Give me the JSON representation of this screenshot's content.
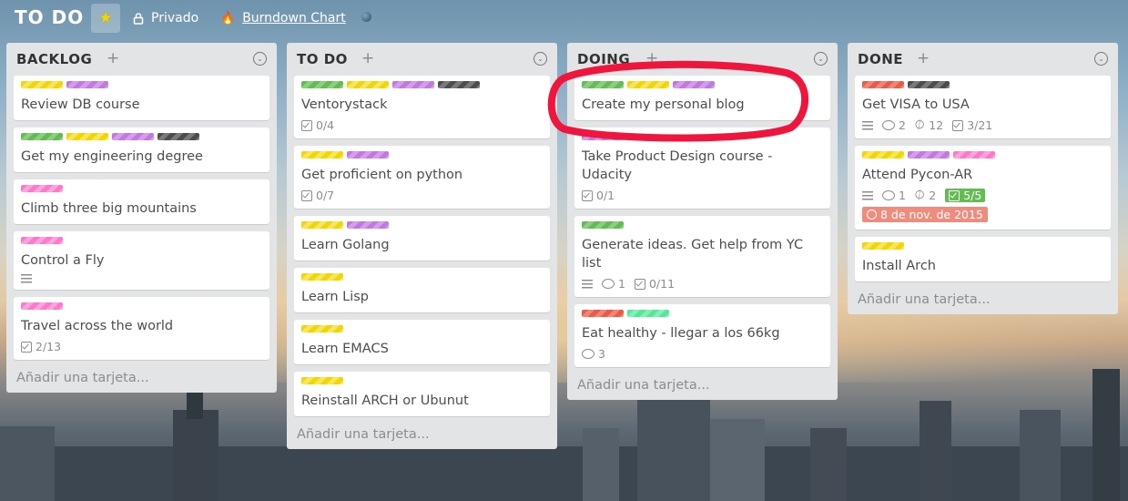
{
  "header": {
    "board_title": "TO DO",
    "star_icon": "★",
    "privacy_label": "Privado",
    "burndown_label": "Burndown Chart"
  },
  "add_card_label": "Añadir una tarjeta...",
  "label_colors": {
    "yellow": "#f2d600",
    "purple": "#c377e0",
    "green": "#61bd4f",
    "black": "#4d4d4d",
    "pink": "#ff78cb",
    "red": "#eb5a46",
    "lime": "#51e898"
  },
  "lists": [
    {
      "title": "BACKLOG",
      "cards": [
        {
          "title": "Review DB course",
          "labels": [
            "yellow",
            "purple"
          ],
          "badges": []
        },
        {
          "title": "Get my engineering degree",
          "labels": [
            "green",
            "yellow",
            "purple",
            "black"
          ],
          "badges": []
        },
        {
          "title": "Climb three big mountains",
          "labels": [
            "pink"
          ],
          "badges": []
        },
        {
          "title": "Control a Fly",
          "labels": [
            "pink"
          ],
          "badges": [
            {
              "type": "description"
            }
          ]
        },
        {
          "title": "Travel across the world",
          "labels": [
            "pink"
          ],
          "badges": [
            {
              "type": "checklist",
              "text": "2/13"
            }
          ]
        }
      ]
    },
    {
      "title": "TO DO",
      "cards": [
        {
          "title": "Ventorystack",
          "labels": [
            "green",
            "yellow",
            "purple",
            "black"
          ],
          "badges": [
            {
              "type": "checklist",
              "text": "0/4"
            }
          ]
        },
        {
          "title": "Get proficient on python",
          "labels": [
            "yellow",
            "purple"
          ],
          "badges": [
            {
              "type": "checklist",
              "text": "0/7"
            }
          ]
        },
        {
          "title": "Learn Golang",
          "labels": [
            "yellow",
            "purple"
          ],
          "badges": []
        },
        {
          "title": "Learn Lisp",
          "labels": [
            "yellow"
          ],
          "badges": []
        },
        {
          "title": "Learn EMACS",
          "labels": [
            "yellow"
          ],
          "badges": []
        },
        {
          "title": "Reinstall ARCH or Ubunut",
          "labels": [
            "yellow"
          ],
          "badges": []
        }
      ]
    },
    {
      "title": "DOING",
      "cards": [
        {
          "title": "Create my personal blog",
          "labels": [
            "green",
            "yellow",
            "purple"
          ],
          "badges": []
        },
        {
          "title": "Take Product Design course - Udacity",
          "labels": [
            "purple"
          ],
          "badges": [
            {
              "type": "checklist",
              "text": "0/1"
            }
          ]
        },
        {
          "title": "Generate ideas. Get help from YC list",
          "labels": [
            "green"
          ],
          "badges": [
            {
              "type": "description"
            },
            {
              "type": "comments",
              "text": "1"
            },
            {
              "type": "checklist",
              "text": "0/11"
            }
          ]
        },
        {
          "title": "Eat healthy - llegar a los 66kg",
          "labels": [
            "red",
            "lime"
          ],
          "badges": [
            {
              "type": "comments",
              "text": "3"
            }
          ]
        }
      ]
    },
    {
      "title": "DONE",
      "cards": [
        {
          "title": "Get VISA to USA",
          "labels": [
            "red",
            "black"
          ],
          "badges": [
            {
              "type": "description"
            },
            {
              "type": "comments",
              "text": "2"
            },
            {
              "type": "attachments",
              "text": "12"
            },
            {
              "type": "checklist",
              "text": "3/21"
            }
          ]
        },
        {
          "title": "Attend Pycon-AR",
          "labels": [
            "yellow",
            "purple",
            "pink"
          ],
          "badges": [
            {
              "type": "description"
            },
            {
              "type": "comments",
              "text": "1"
            },
            {
              "type": "attachments",
              "text": "2"
            },
            {
              "type": "checklist-complete",
              "text": "5/5"
            }
          ],
          "due": "8 de nov. de 2015"
        },
        {
          "title": "Install Arch",
          "labels": [
            "yellow"
          ],
          "badges": []
        }
      ]
    }
  ]
}
